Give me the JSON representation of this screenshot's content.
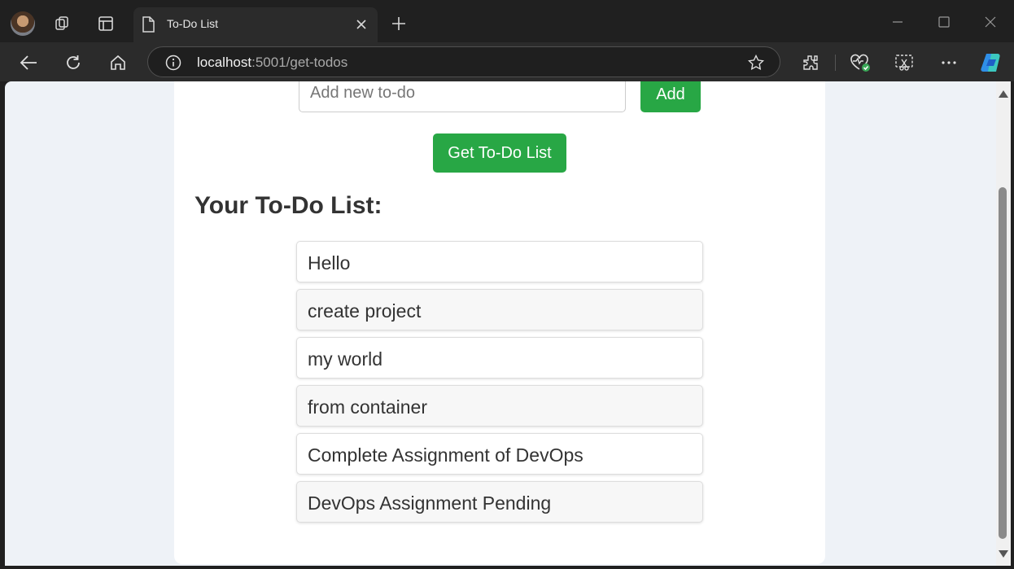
{
  "browser": {
    "tab_title": "To-Do List",
    "url_host": "localhost",
    "url_rest": ":5001/get-todos"
  },
  "page": {
    "input_placeholder": "Add new to-do",
    "add_label": "Add",
    "get_label": "Get To-Do List",
    "heading": "Your To-Do List:",
    "todos": [
      "Hello",
      "create project",
      "my world",
      "from container",
      "Complete Assignment of DevOps",
      "DevOps Assignment Pending"
    ]
  },
  "icons": [
    "profile-avatar",
    "workspaces-icon",
    "tab-actions-icon",
    "page-icon",
    "close-icon",
    "new-tab-icon",
    "minimize-icon",
    "maximize-icon",
    "window-close-icon",
    "back-icon",
    "refresh-icon",
    "home-icon",
    "site-info-icon",
    "favorite-icon",
    "extensions-icon",
    "browser-essentials-icon",
    "screenshot-icon",
    "more-icon",
    "copilot-icon"
  ],
  "colors": {
    "accent": "#28a745",
    "page_bg": "#eef2f7",
    "chrome": "#202020"
  }
}
